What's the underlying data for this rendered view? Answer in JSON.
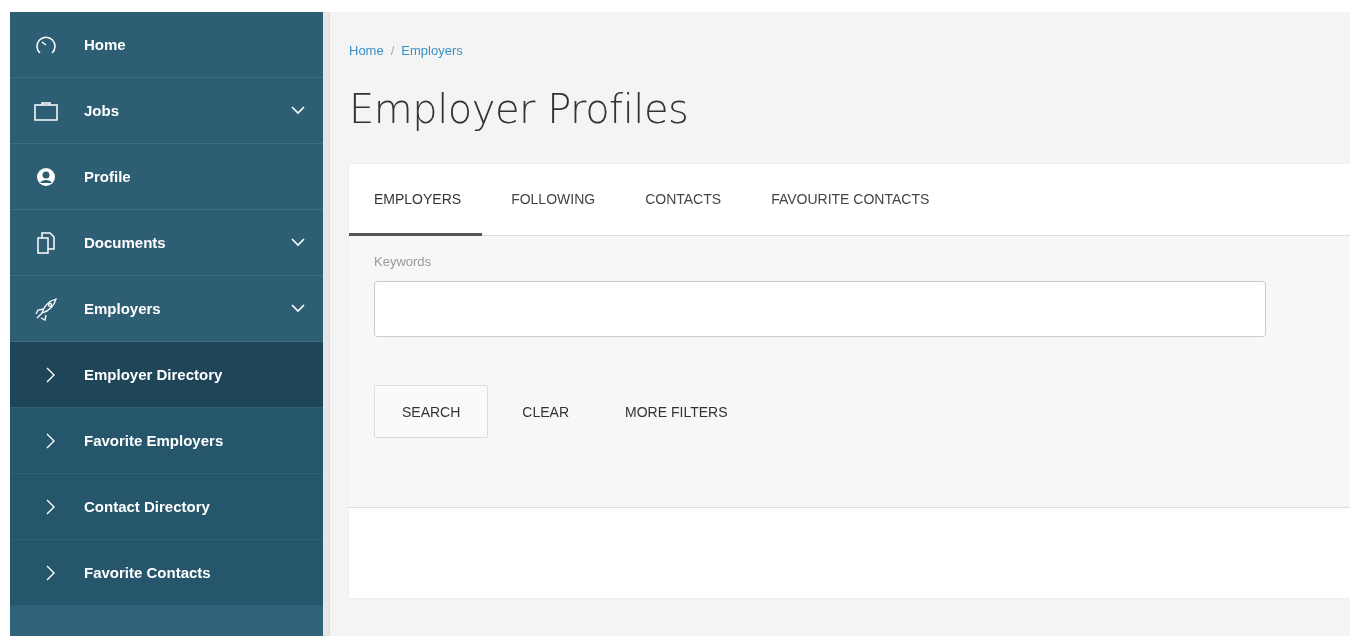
{
  "sidebar": {
    "items": [
      {
        "label": "Home",
        "kind": "gauge",
        "selected": false
      },
      {
        "label": "Jobs",
        "kind": "briefcase",
        "selected": false,
        "has_submenu": true
      },
      {
        "label": "Profile",
        "kind": "person",
        "selected": false
      },
      {
        "label": "Documents",
        "kind": "documents",
        "selected": false,
        "has_submenu": true
      },
      {
        "label": "Employers",
        "kind": "rocket",
        "selected": false,
        "has_submenu": true,
        "children": [
          {
            "label": "Employer Directory",
            "selected": true
          },
          {
            "label": "Favorite Employers",
            "selected": false
          },
          {
            "label": "Contact Directory",
            "selected": false
          },
          {
            "label": "Favorite Contacts",
            "selected": false
          }
        ]
      }
    ]
  },
  "breadcrumb": [
    "Home",
    "Employers"
  ],
  "breadcrumb_separator": "/",
  "page_title": "Employer Profiles",
  "tabs": [
    {
      "label": "EMPLOYERS",
      "selected": true
    },
    {
      "label": "FOLLOWING",
      "selected": false
    },
    {
      "label": "CONTACTS",
      "selected": false
    },
    {
      "label": "FAVOURITE CONTACTS",
      "selected": false
    }
  ],
  "filters": {
    "keywords_label": "Keywords",
    "buttons": [
      {
        "label": "SEARCH",
        "kind": "outlined"
      },
      {
        "label": "CLEAR",
        "kind": "text"
      },
      {
        "label": "MORE FILTERS",
        "kind": "text"
      }
    ]
  }
}
